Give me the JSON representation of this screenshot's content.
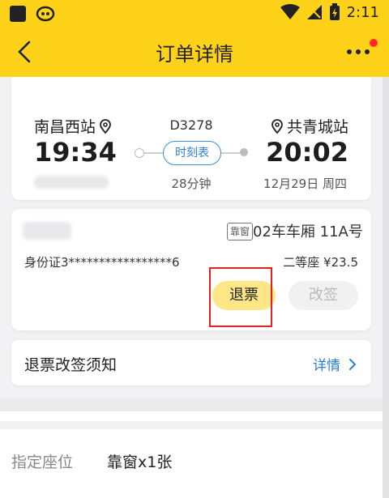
{
  "status_bar": {
    "time": "2:11"
  },
  "nav": {
    "title": "订单详情"
  },
  "trip": {
    "from_station": "南昌西站",
    "to_station": "共青城站",
    "train_no": "D3278",
    "depart_time": "19:34",
    "arrive_time": "20:02",
    "schedule_label": "时刻表",
    "duration": "28分钟",
    "date": "12月29日 周四"
  },
  "passenger": {
    "seat_tag": "靠窗",
    "seat_no": "02车车厢 11A号",
    "id_card": "身份证3*****************6",
    "seat_class": "二等座 ¥23.5",
    "refund_label": "退票",
    "change_label": "改签"
  },
  "notice": {
    "title": "退票改签须知",
    "detail_label": "详情"
  },
  "seat_pref": {
    "label": "指定座位",
    "value": "靠窗x1张"
  },
  "colors": {
    "brand": "#ffd21a",
    "link": "#2a7fd0",
    "highlight": "#e52020"
  }
}
